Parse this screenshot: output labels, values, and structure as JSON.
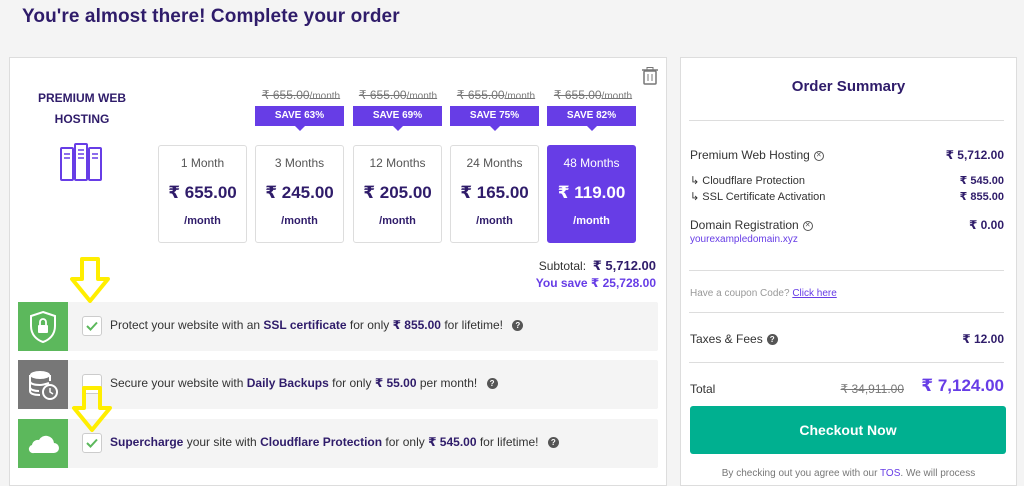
{
  "header": {
    "title": "You're almost there! Complete your order"
  },
  "product": {
    "name": "PREMIUM WEB HOSTING",
    "icon": "server-icon",
    "delete_icon": "trash-icon"
  },
  "plans": [
    {
      "term": "1 Month",
      "price": "₹ 655.00",
      "per": "/month",
      "old_price": "",
      "old_unit": "",
      "save": "",
      "selected": false
    },
    {
      "term": "3 Months",
      "price": "₹ 245.00",
      "per": "/month",
      "old_price": "₹ 655.00",
      "old_unit": "/month",
      "save": "SAVE 63%",
      "selected": false
    },
    {
      "term": "12 Months",
      "price": "₹ 205.00",
      "per": "/month",
      "old_price": "₹ 655.00",
      "old_unit": "/month",
      "save": "SAVE 69%",
      "selected": false
    },
    {
      "term": "24 Months",
      "price": "₹ 165.00",
      "per": "/month",
      "old_price": "₹ 655.00",
      "old_unit": "/month",
      "save": "SAVE 75%",
      "selected": false
    },
    {
      "term": "48 Months",
      "price": "₹ 119.00",
      "per": "/month",
      "old_price": "₹ 655.00",
      "old_unit": "/month",
      "save": "SAVE 82%",
      "selected": true
    }
  ],
  "totals": {
    "subtotal_label": "Subtotal:",
    "subtotal_value": "₹ 5,712.00",
    "you_save_label": "You save",
    "you_save_value": "₹ 25,728.00"
  },
  "addons": [
    {
      "icon": "ssl-lock-icon",
      "icon_color": "#5cb85c",
      "checked": true,
      "pre": "Protect your website with an ",
      "bold": "SSL certificate",
      "mid": " for only ",
      "price": "₹ 855.00",
      "post": " for lifetime!"
    },
    {
      "icon": "backup-database-icon",
      "icon_color": "#777777",
      "checked": false,
      "pre": "Secure your website with ",
      "bold": "Daily Backups",
      "mid": " for only ",
      "price": "₹ 55.00",
      "post": " per month!"
    },
    {
      "icon": "cloudflare-cloud-icon",
      "icon_color": "#5cb85c",
      "checked": true,
      "pre": "",
      "bold_lead": "Supercharge",
      "pre2": " your site with ",
      "bold": "Cloudflare Protection",
      "mid": " for only ",
      "price": "₹ 545.00",
      "post": " for lifetime!"
    }
  ],
  "summary": {
    "title": "Order Summary",
    "hosting_label": "Premium Web Hosting",
    "hosting_value": "₹ 5,712.00",
    "cloudflare_label": "↳ Cloudflare Protection",
    "cloudflare_value": "₹ 545.00",
    "ssl_label": "↳ SSL Certificate Activation",
    "ssl_value": "₹ 855.00",
    "domain_label": "Domain Registration",
    "domain_value": "₹ 0.00",
    "domain_name": "yourexampledomain.xyz",
    "coupon_text": "Have a coupon Code?",
    "coupon_link": "Click here",
    "taxes_label": "Taxes & Fees",
    "taxes_value": "₹ 12.00",
    "total_label": "Total",
    "total_old": "₹ 34,911.00",
    "total_new": "₹ 7,124.00",
    "checkout_label": "Checkout Now",
    "tos_pre": "By checking out you agree with our ",
    "tos_link": "TOS",
    "tos_post": ". We will process"
  },
  "colors": {
    "accent": "#673de6",
    "checkout": "#00b090",
    "arrow": "#ffee00"
  }
}
